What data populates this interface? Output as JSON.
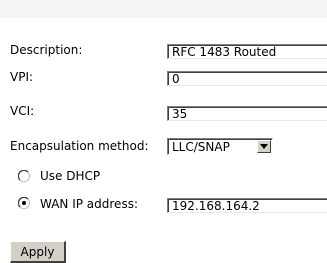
{
  "form": {
    "description": {
      "label": "Description:",
      "value": "RFC 1483 Routed"
    },
    "vpi": {
      "label": "VPI:",
      "value": "0"
    },
    "vci": {
      "label": "VCI:",
      "value": "35"
    },
    "encapsulation": {
      "label": "Encapsulation method:",
      "selected": "LLC/SNAP"
    },
    "use_dhcp": {
      "label": "Use DHCP",
      "checked": false
    },
    "wan_ip": {
      "label": "WAN IP address:",
      "checked": true,
      "value": "192.168.164.2"
    },
    "apply_label": "Apply"
  }
}
